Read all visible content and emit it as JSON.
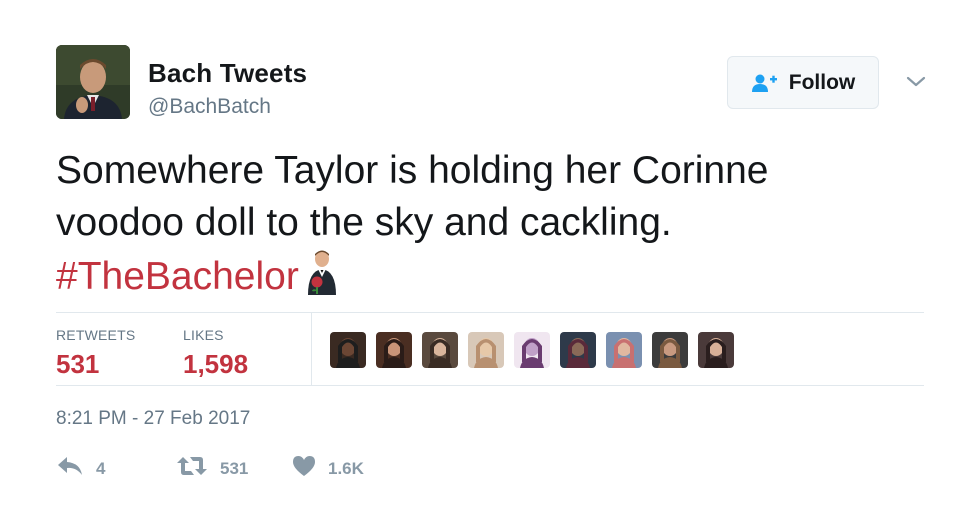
{
  "author": {
    "name": "Bach Tweets",
    "handle": "@BachBatch",
    "avatar_icon": "profile-photo-man-in-suit"
  },
  "follow_button": {
    "label": "Follow",
    "icon": "add-user-icon"
  },
  "menu_icon": "chevron-down-icon",
  "tweet": {
    "line1": "Somewhere Taylor is holding her Corinne",
    "line2": "voodoo doll to the sky and cackling.",
    "hashtag": "#TheBachelor",
    "hashtag_emoji": "bachelor-rose-emoji"
  },
  "stats": {
    "retweets_label": "RETWEETS",
    "retweets_value": "531",
    "likes_label": "LIKES",
    "likes_value": "1,598",
    "likers_count": 9
  },
  "timestamp": "8:21 PM - 27 Feb 2017",
  "actions": {
    "reply_count": "4",
    "retweet_count": "531",
    "like_count": "1.6K"
  },
  "colors": {
    "accent": "#c2333f",
    "muted": "#657786",
    "icon": "#8899a6",
    "follow_icon": "#1da1f2"
  }
}
